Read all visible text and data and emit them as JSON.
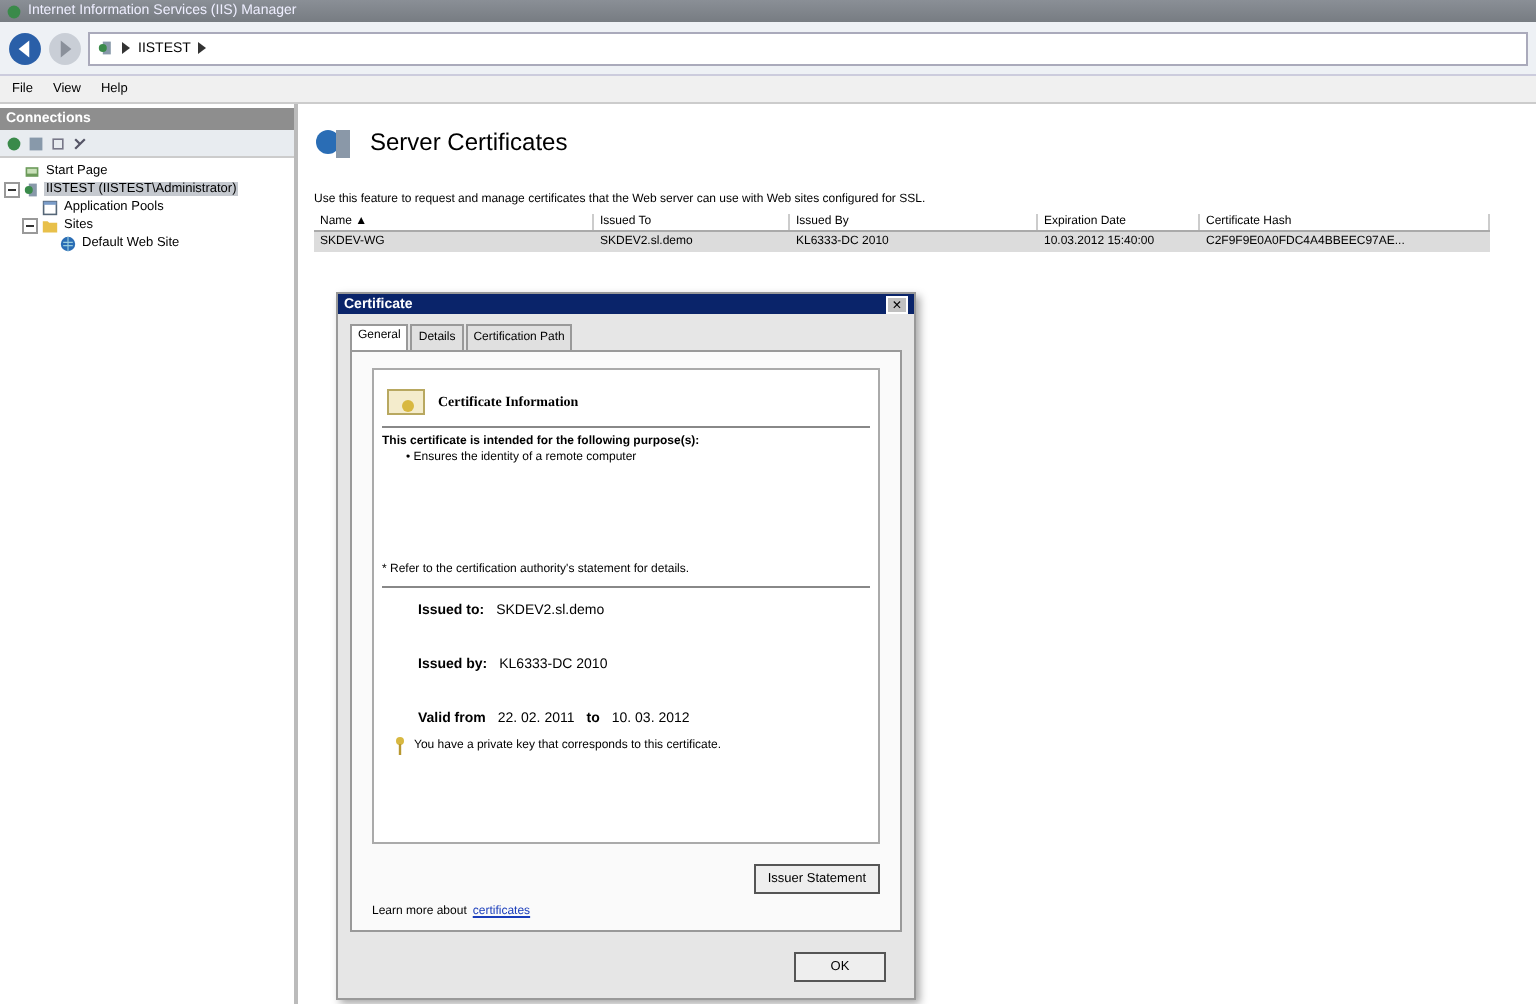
{
  "window": {
    "title": "Internet Information Services (IIS) Manager"
  },
  "address_bar": {
    "segments": [
      "IISTEST"
    ]
  },
  "menu": [
    "File",
    "View",
    "Help"
  ],
  "connections": {
    "title": "Connections",
    "tree": [
      {
        "label": "Start Page",
        "kind": "start"
      },
      {
        "label": "IISTEST (IISTEST\\Administrator)",
        "kind": "server",
        "selected": true,
        "expanded": true,
        "children": [
          {
            "label": "Application Pools",
            "kind": "pools"
          },
          {
            "label": "Sites",
            "kind": "folder",
            "expanded": true,
            "children": [
              {
                "label": "Default Web Site",
                "kind": "site"
              }
            ]
          }
        ]
      }
    ]
  },
  "feature": {
    "title": "Server Certificates",
    "description": "Use this feature to request and manage certificates that the Web server can use with Web sites configured for SSL."
  },
  "table": {
    "columns": [
      "Name ▲",
      "Issued To",
      "Issued By",
      "Expiration Date",
      "Certificate Hash"
    ],
    "rows": [
      {
        "cells": [
          "SKDEV-WG",
          "SKDEV2.sl.demo",
          "KL6333-DC 2010",
          "10.03.2012 15:40:00",
          "C2F9F9E0A0FDC4A4BBEEC97AE..."
        ],
        "selected": true
      }
    ]
  },
  "dialog": {
    "title": "Certificate",
    "close": "×",
    "tabs": [
      {
        "label": "General",
        "selected": true
      },
      {
        "label": "Details",
        "selected": false
      },
      {
        "label": "Certification Path",
        "selected": false
      }
    ],
    "info_title": "Certificate Information",
    "purpose_heading": "This certificate is intended for the following purpose(s):",
    "purposes": [
      "• Ensures the identity of a remote computer"
    ],
    "note": "* Refer to the certification authority's statement for details.",
    "fields": [
      {
        "label": "Issued to:",
        "value": "SKDEV2.sl.demo"
      },
      {
        "label": "Issued by:",
        "value": "KL6333-DC 2010"
      }
    ],
    "valid": {
      "label": "Valid from",
      "from": "22. 02. 2011",
      "to_label": "to",
      "to": "10. 03. 2012"
    },
    "key_note": "You have a private key that corresponds to this certificate.",
    "issuer_button": "Issuer Statement",
    "learn_more": {
      "text": "Learn more about",
      "link": "certificates"
    },
    "ok_button": "OK"
  }
}
